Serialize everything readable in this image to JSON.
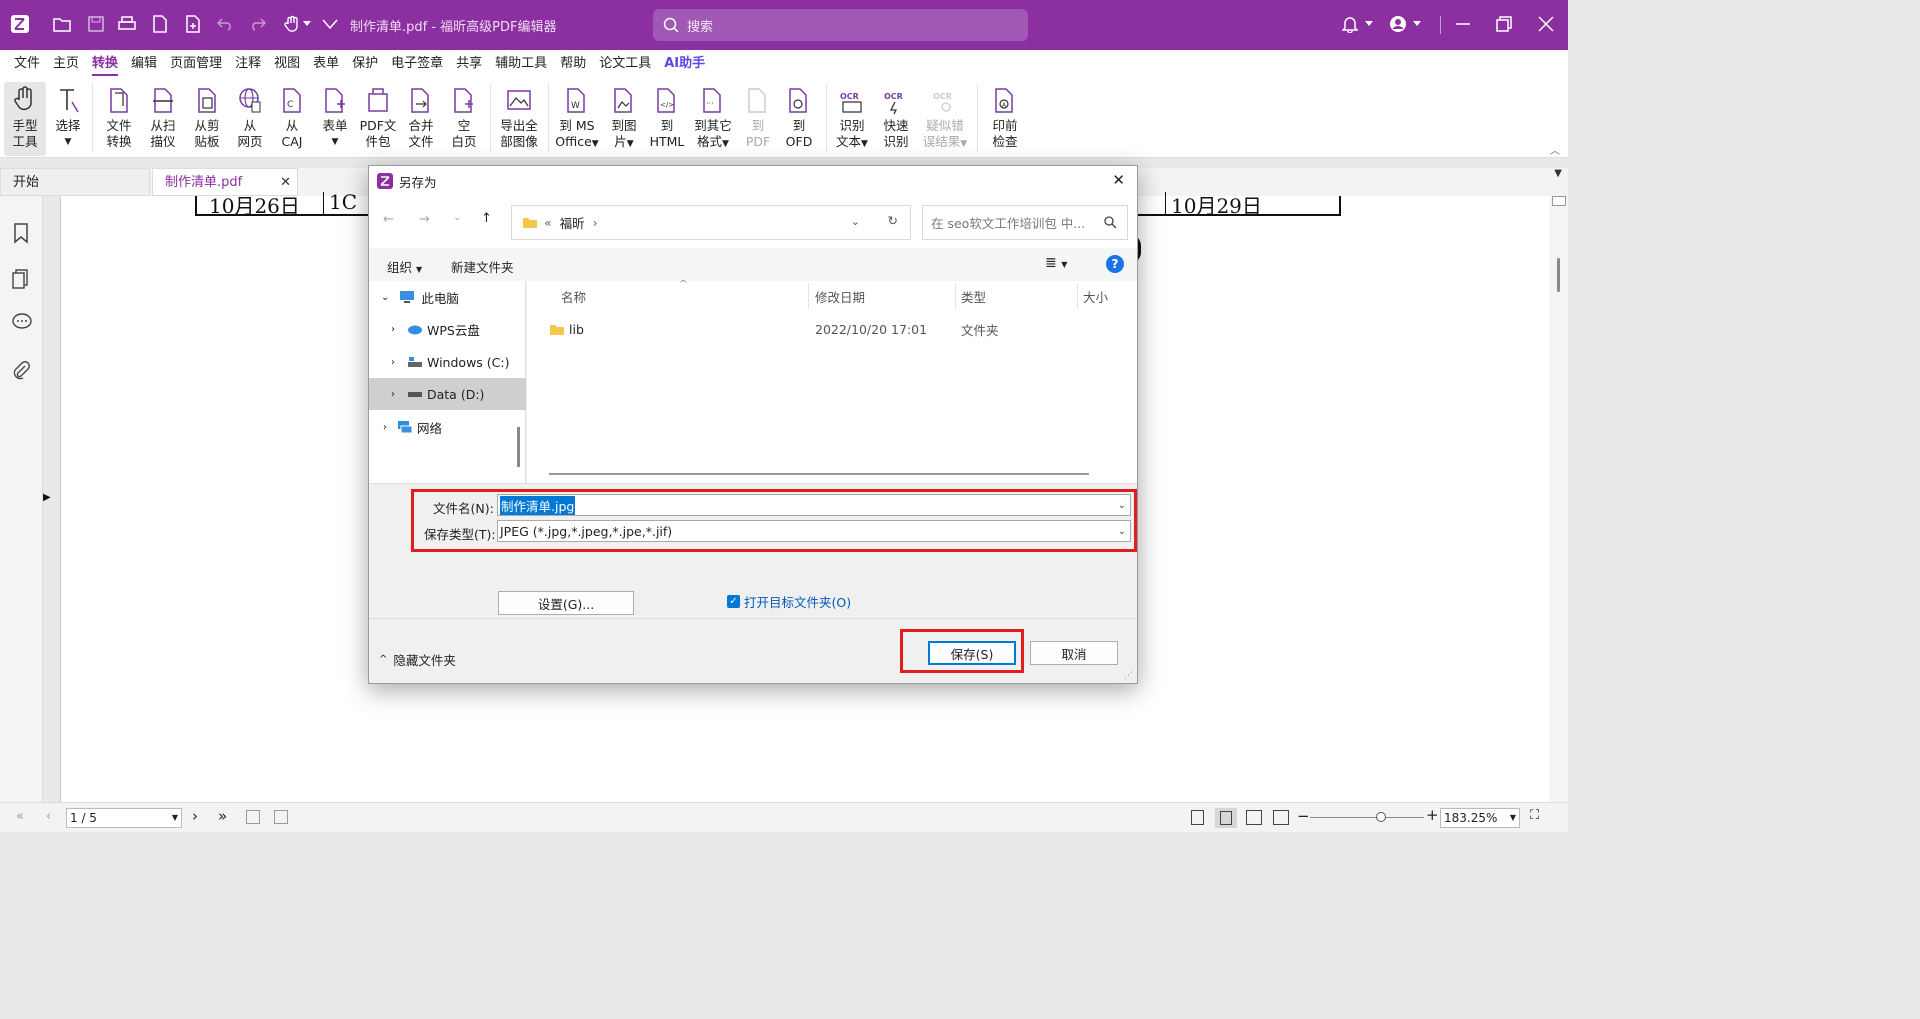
{
  "titlebar": {
    "window_title": "制作清单.pdf - 福昕高级PDF编辑器",
    "search_placeholder": "搜索",
    "brand_color": "#8b2fa1"
  },
  "menu": {
    "items": [
      "文件",
      "主页",
      "转换",
      "编辑",
      "页面管理",
      "注释",
      "视图",
      "表单",
      "保护",
      "电子签章",
      "共享",
      "辅助工具",
      "帮助",
      "论文工具"
    ],
    "active": "转换",
    "ai_label": "AI助手"
  },
  "ribbon": {
    "buttons": [
      {
        "l1": "手型",
        "l2": "工具"
      },
      {
        "l1": "选择",
        "l2": ""
      },
      {
        "l1": "文件",
        "l2": "转换"
      },
      {
        "l1": "从扫",
        "l2": "描仪"
      },
      {
        "l1": "从剪",
        "l2": "贴板"
      },
      {
        "l1": "从",
        "l2": "网页"
      },
      {
        "l1": "从",
        "l2": "CAJ"
      },
      {
        "l1": "表单",
        "l2": ""
      },
      {
        "l1": "PDF文",
        "l2": "件包"
      },
      {
        "l1": "合并",
        "l2": "文件"
      },
      {
        "l1": "空",
        "l2": "白页"
      },
      {
        "l1": "导出全",
        "l2": "部图像"
      },
      {
        "l1": "到 MS",
        "l2": "Office"
      },
      {
        "l1": "到图",
        "l2": "片"
      },
      {
        "l1": "到",
        "l2": "HTML"
      },
      {
        "l1": "到其它",
        "l2": "格式"
      },
      {
        "l1": "到",
        "l2": "PDF"
      },
      {
        "l1": "到",
        "l2": "OFD"
      },
      {
        "l1": "识别",
        "l2": "文本"
      },
      {
        "l1": "快速",
        "l2": "识别"
      },
      {
        "l1": "疑似错",
        "l2": "误结果"
      },
      {
        "l1": "印前",
        "l2": "检查"
      }
    ]
  },
  "tabs": {
    "start": "开始",
    "doc": "制作清单.pdf"
  },
  "document": {
    "date_left": "10月26日",
    "frag": "1C",
    "date_right": "10月29日"
  },
  "dialog": {
    "title": "另存为",
    "path_prefix": "«",
    "path_folder": "福昕",
    "search_placeholder": "在 seo软文工作培训包 中...",
    "organize": "组织",
    "new_folder": "新建文件夹",
    "nav": [
      {
        "label": "此电脑"
      },
      {
        "label": "WPS云盘"
      },
      {
        "label": "Windows (C:)"
      },
      {
        "label": "Data (D:)"
      },
      {
        "label": "网络"
      }
    ],
    "columns": {
      "name": "名称",
      "date": "修改日期",
      "type": "类型",
      "size": "大小"
    },
    "rows": [
      {
        "name": "lib",
        "date": "2022/10/20 17:01",
        "type": "文件夹"
      }
    ],
    "filename_label": "文件名(N):",
    "filename_value": "制作清单.jpg",
    "filetype_label": "保存类型(T):",
    "filetype_value": "JPEG (*.jpg,*.jpeg,*.jpe,*.jif)",
    "settings_btn": "设置(G)...",
    "open_folder_chk": "打开目标文件夹(O)",
    "hide_folders": "隐藏文件夹",
    "save_btn": "保存(S)",
    "cancel_btn": "取消",
    "highlight_color": "#e11d1d"
  },
  "status": {
    "page": "1 / 5",
    "zoom": "183.25%"
  }
}
